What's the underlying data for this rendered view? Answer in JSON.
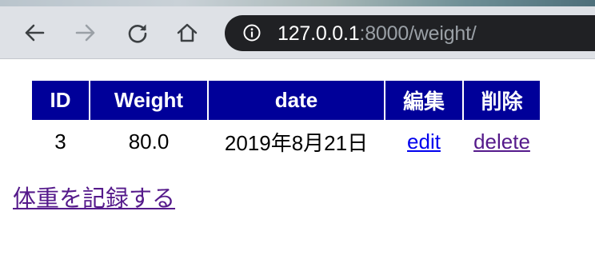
{
  "browser": {
    "url_host": "127.0.0.1",
    "url_rest": ":8000/weight/",
    "icons": {
      "back": "back-arrow-icon",
      "forward": "forward-arrow-icon",
      "reload": "reload-icon",
      "home": "home-icon",
      "site_info": "info-icon"
    }
  },
  "table": {
    "headers": [
      "ID",
      "Weight",
      "date",
      "編集",
      "削除"
    ],
    "header_bg": "#000099",
    "rows": [
      {
        "id": "3",
        "weight": "80.0",
        "date": "2019年8月21日",
        "edit": "edit",
        "delete": "delete"
      }
    ]
  },
  "record_link": "体重を記録する"
}
